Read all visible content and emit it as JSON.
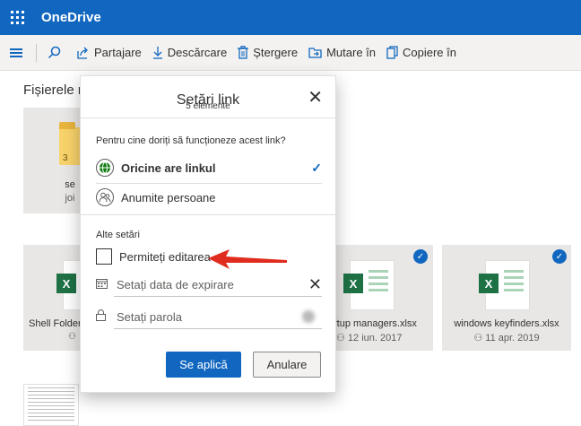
{
  "app": {
    "title": "OneDrive"
  },
  "commands": [
    {
      "label": "Partajare",
      "icon": "share-icon"
    },
    {
      "label": "Descărcare",
      "icon": "download-icon"
    },
    {
      "label": "Ștergere",
      "icon": "trash-icon"
    },
    {
      "label": "Mutare în",
      "icon": "move-icon"
    },
    {
      "label": "Copiere în",
      "icon": "copy-icon"
    }
  ],
  "main": {
    "heading": "Fișierele m"
  },
  "tiles": [
    {
      "name": "se",
      "sub": "joi",
      "kind": "folder",
      "count": "3"
    },
    {
      "name": "Shell Folder",
      "sub": "",
      "kind": "excel"
    },
    {
      "name": "rtup managers.xlsx",
      "sub": "12 iun. 2017",
      "kind": "excel"
    },
    {
      "name": "windows keyfinders.xlsx",
      "sub": "11 apr. 2019",
      "kind": "excel"
    }
  ],
  "dialog": {
    "title": "Setări link",
    "subtitle": "5 elemente",
    "question": "Pentru cine doriți să funcționeze acest link?",
    "options": [
      {
        "label": "Oricine are linkul",
        "selected": true
      },
      {
        "label": "Anumite persoane",
        "selected": false
      }
    ],
    "other_settings": "Alte setări",
    "allow_editing": "Permiteți editarea",
    "allow_editing_checked": false,
    "expiry_placeholder": "Setați data de expirare",
    "password_placeholder": "Setați parola",
    "apply_label": "Se aplică",
    "cancel_label": "Anulare"
  },
  "colors": {
    "brand": "#1167bf",
    "excel": "#1e7145",
    "annotation_arrow": "#e02b1f"
  }
}
